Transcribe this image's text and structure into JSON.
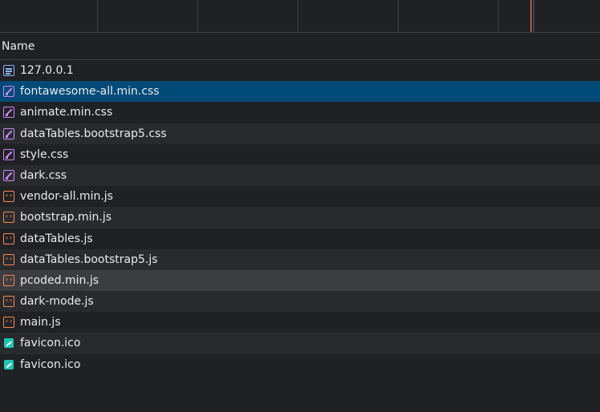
{
  "table": {
    "header_name": "Name"
  },
  "rows": [
    {
      "name": "127.0.0.1",
      "type": "document",
      "icon": "document-icon"
    },
    {
      "name": "fontawesome-all.min.css",
      "type": "stylesheet",
      "icon": "stylesheet-icon",
      "selected": true
    },
    {
      "name": "animate.min.css",
      "type": "stylesheet",
      "icon": "stylesheet-icon"
    },
    {
      "name": "dataTables.bootstrap5.css",
      "type": "stylesheet",
      "icon": "stylesheet-icon"
    },
    {
      "name": "style.css",
      "type": "stylesheet",
      "icon": "stylesheet-icon"
    },
    {
      "name": "dark.css",
      "type": "stylesheet",
      "icon": "stylesheet-icon"
    },
    {
      "name": "vendor-all.min.js",
      "type": "script",
      "icon": "script-icon"
    },
    {
      "name": "bootstrap.min.js",
      "type": "script",
      "icon": "script-icon"
    },
    {
      "name": "dataTables.js",
      "type": "script",
      "icon": "script-icon"
    },
    {
      "name": "dataTables.bootstrap5.js",
      "type": "script",
      "icon": "script-icon"
    },
    {
      "name": "pcoded.min.js",
      "type": "script",
      "icon": "script-icon",
      "hover": true
    },
    {
      "name": "dark-mode.js",
      "type": "script",
      "icon": "script-icon"
    },
    {
      "name": "main.js",
      "type": "script",
      "icon": "script-icon"
    },
    {
      "name": "favicon.ico",
      "type": "image",
      "icon": "image-icon"
    },
    {
      "name": "favicon.ico",
      "type": "image",
      "icon": "image-icon"
    }
  ],
  "colors": {
    "selected_row": "#004a77",
    "document": "#8ab4f8",
    "stylesheet": "#c58af9",
    "script": "#f28b54",
    "image": "#1fc6b0"
  }
}
